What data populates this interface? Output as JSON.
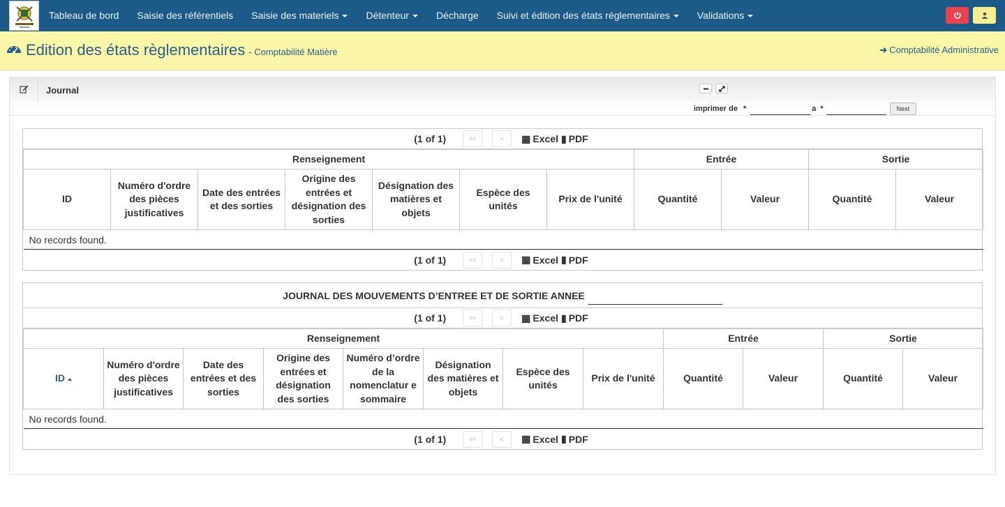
{
  "nav": {
    "items": [
      {
        "label": "Tableau de bord",
        "dropdown": false
      },
      {
        "label": "Saisie des référentiels",
        "dropdown": false
      },
      {
        "label": "Saisie des materiels",
        "dropdown": true
      },
      {
        "label": "Détenteur",
        "dropdown": true
      },
      {
        "label": "Décharge",
        "dropdown": false
      },
      {
        "label": "Suivi et édition des états réglementaires",
        "dropdown": true
      },
      {
        "label": "Validations",
        "dropdown": true
      }
    ],
    "power_icon": "power-icon",
    "user_icon": "user-icon"
  },
  "header": {
    "icon": "dashboard-icon",
    "title": "Edition des états règlementaires",
    "subtitle": "- Comptabilité Matière",
    "admin_link": "Comptabilité Administrative"
  },
  "panel": {
    "title": "Journal",
    "print": {
      "label": "imprimer de",
      "star": "*",
      "to_label": "a",
      "from_value": "",
      "to_value": "",
      "next_label": "Next"
    }
  },
  "table1": {
    "pager": {
      "count": "(1 of 1)",
      "first": "<<",
      "prev": "<",
      "excel": "Excel",
      "pdf": "PDF"
    },
    "groups": [
      "Renseignement",
      "Entrée",
      "Sortie"
    ],
    "columns": [
      "ID",
      "Numéro d'ordre des pièces justificatives",
      "Date des entrées et des sorties",
      "Origine des entrées et désignation des sorties",
      "Désignation des matières et objets",
      "Espèce des unités",
      "Prix de l'unité",
      "Quantité",
      "Valeur",
      "Quantité",
      "Valeur"
    ],
    "empty": "No records found."
  },
  "table2": {
    "caption": "JOURNAL DES MOUVEMENTS D’ENTREE ET DE SORTIE ANNEE",
    "pager": {
      "count": "(1 of 1)",
      "first": "<<",
      "prev": "<",
      "excel": "Excel",
      "pdf": "PDF"
    },
    "groups": [
      "Renseignement",
      "Entrée",
      "Sortie"
    ],
    "columns": [
      "ID",
      "Numéro d'ordre des pièces justificatives",
      "Date des entrées et des sorties",
      "Origine des entrées et désignation des sorties",
      "Numéro d’ordre de la nomenclatur e sommaire",
      "Désignation des matières et objets",
      "Espèce des unités",
      "Prix de l'unité",
      "Quantité",
      "Valeur",
      "Quantité",
      "Valeur"
    ],
    "empty": "No records found."
  },
  "colors": {
    "navbar": "#1c5a8a",
    "header_bg": "#fbf7a8",
    "accent": "#2a5f8c",
    "danger": "#e8434f",
    "warning": "#f6ef92"
  }
}
